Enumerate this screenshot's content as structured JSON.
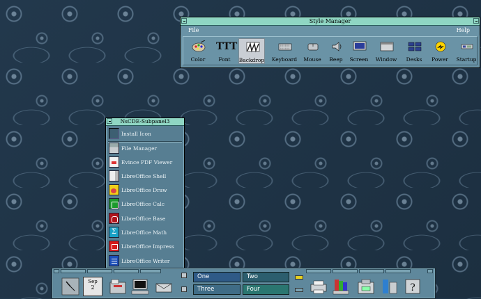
{
  "style_manager": {
    "title": "Style Manager",
    "menu_file": "File",
    "menu_help": "Help",
    "tools": [
      {
        "label": "Color",
        "icon": "palette-icon"
      },
      {
        "label": "Font",
        "icon": "font-icon",
        "glyph": "TTT"
      },
      {
        "label": "Backdrop",
        "icon": "backdrop-icon",
        "selected": true
      },
      {
        "label": "Keyboard",
        "icon": "keyboard-icon"
      },
      {
        "label": "Mouse",
        "icon": "mouse-icon"
      },
      {
        "label": "Beep",
        "icon": "speaker-icon"
      },
      {
        "label": "Screen",
        "icon": "monitor-icon"
      },
      {
        "label": "Window",
        "icon": "window-icon"
      },
      {
        "label": "Desks",
        "icon": "desks-icon"
      },
      {
        "label": "Power",
        "icon": "power-icon"
      },
      {
        "label": "Startup",
        "icon": "startup-icon"
      }
    ]
  },
  "subpanel": {
    "title": "NsCDE-Subpanel3",
    "install_label": "Install Icon",
    "items": [
      {
        "label": "File Manager",
        "icon": "file-manager-icon"
      },
      {
        "label": "Evince PDF Viewer",
        "icon": "pdf-icon"
      },
      {
        "label": "LibreOffice Shell",
        "icon": "libreoffice-icon"
      },
      {
        "label": "LibreOffice Draw",
        "icon": "draw-icon"
      },
      {
        "label": "LibreOffice Calc",
        "icon": "calc-icon"
      },
      {
        "label": "LibreOffice Base",
        "icon": "base-icon"
      },
      {
        "label": "LibreOffice Math",
        "icon": "math-icon"
      },
      {
        "label": "LibreOffice Impress",
        "icon": "impress-icon"
      },
      {
        "label": "LibreOffice Writer",
        "icon": "writer-icon"
      }
    ]
  },
  "front_panel": {
    "calendar_month": "Sep",
    "calendar_day": "2",
    "workspaces": [
      "One",
      "Two",
      "Three",
      "Four"
    ],
    "active_workspace": "One"
  },
  "colors": {
    "titlebar": "#8fd6c3",
    "panel": "#577e92",
    "ws_one": "#2f5a87",
    "ws_two": "#2c5e6e",
    "ws_three": "#3f6c86",
    "ws_four": "#2a7670"
  }
}
